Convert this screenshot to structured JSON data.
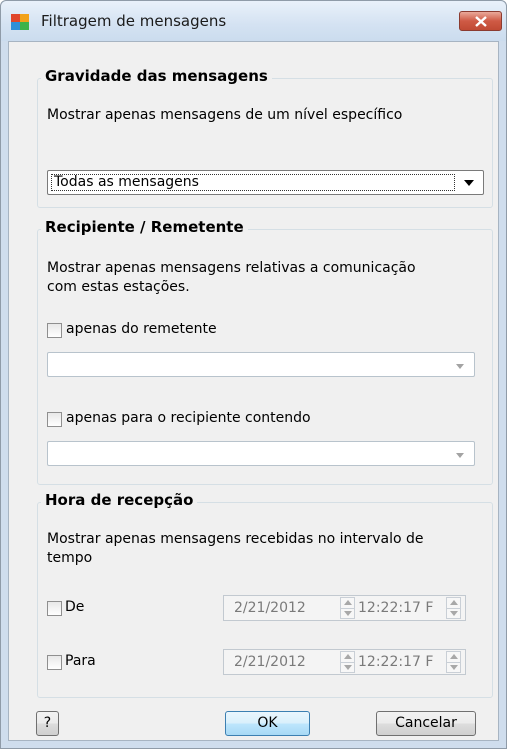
{
  "window": {
    "title": "Filtragem de mensagens"
  },
  "severity": {
    "legend": "Gravidade das mensagens",
    "description": "Mostrar apenas mensagens de um nível específico",
    "selected": "Todas as mensagens"
  },
  "recipient": {
    "legend": "Recipiente / Remetente",
    "description_line1": "Mostrar apenas mensagens relativas a comunicação",
    "description_line2": "com estas estações.",
    "sender_label": "apenas do remetente",
    "sender_checked": false,
    "sender_value": "",
    "recipient_label": "apenas para o recipiente contendo",
    "recipient_checked": false,
    "recipient_value": ""
  },
  "time": {
    "legend": "Hora de recepção",
    "description_line1": "Mostrar apenas mensagens recebidas no intervalo de",
    "description_line2": "tempo",
    "from_label": "De",
    "from_date": "2/21/2012",
    "from_time": "12:22:17 F",
    "to_label": "Para",
    "to_date": "2/21/2012",
    "to_time": "12:22:17 F"
  },
  "buttons": {
    "help": "?",
    "ok": "OK",
    "cancel": "Cancelar"
  },
  "colors": {
    "titlebar": "#d4e2f2",
    "close": "#cf5a45",
    "client": "#f0f0f0",
    "ok_border": "#3c7fb1"
  }
}
